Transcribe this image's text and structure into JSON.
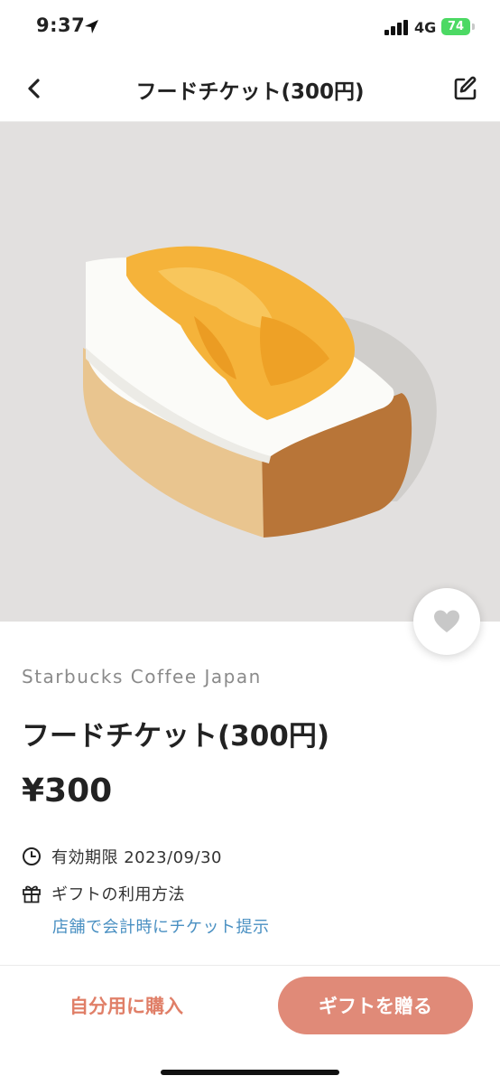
{
  "status_bar": {
    "time": "9:37",
    "network": "4G",
    "battery": "74"
  },
  "nav": {
    "title": "フードチケット(300円)",
    "back_icon": "chevron-left-icon",
    "edit_icon": "edit-pencil-icon"
  },
  "hero": {
    "description_icon": "cake-photo",
    "favorite_icon": "heart-icon"
  },
  "product": {
    "brand": "Starbucks Coffee Japan",
    "title": "フードチケット(300円)",
    "price": "¥300"
  },
  "details": {
    "expiry_label": "有効期限 2023/09/30",
    "howto_label": "ギフトの利用方法",
    "howto_link": "店舗で会計時にチケット提示"
  },
  "footer": {
    "self_buy_label": "自分用に購入",
    "gift_label": "ギフトを贈る"
  },
  "colors": {
    "accent": "#e08a78",
    "accent_text": "#e07f68",
    "link": "#4a90c2",
    "battery": "#4cd964"
  }
}
